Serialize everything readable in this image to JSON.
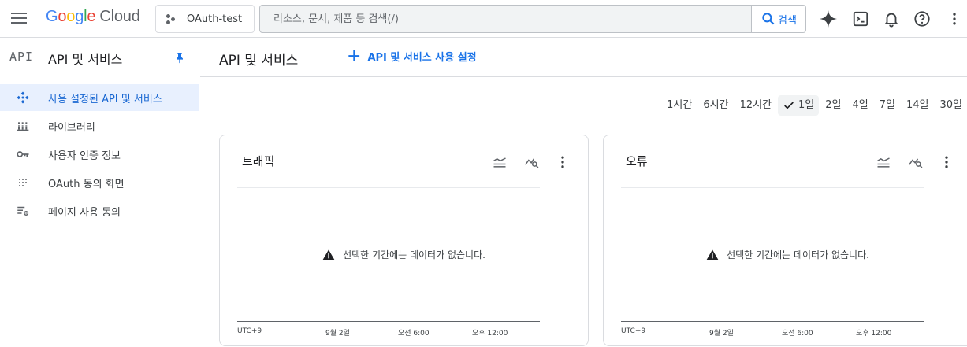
{
  "header": {
    "logo_letters": [
      "G",
      "o",
      "o",
      "g",
      "l",
      "e"
    ],
    "logo_suffix": "Cloud",
    "project_name": "OAuth-test",
    "search_placeholder": "리소스, 문서, 제품 등 검색(/)",
    "search_button": "검색",
    "icons": [
      "menu-icon",
      "gemini-sparkle-icon",
      "cloud-shell-icon",
      "bell-icon",
      "help-icon",
      "more-vert-icon"
    ]
  },
  "sidebar": {
    "logo_text": "API",
    "title": "API 및 서비스",
    "items": [
      {
        "label": "사용 설정된 API 및 서비스",
        "icon": "api-diamond-icon",
        "active": true
      },
      {
        "label": "라이브러리",
        "icon": "library-icon",
        "active": false
      },
      {
        "label": "사용자 인증 정보",
        "icon": "key-icon",
        "active": false
      },
      {
        "label": "OAuth 동의 화면",
        "icon": "consent-dots-icon",
        "active": false
      },
      {
        "label": "페이지 사용 동의",
        "icon": "settings-list-icon",
        "active": false
      }
    ]
  },
  "main": {
    "title": "API 및 서비스",
    "enable_button": "API 및 서비스 사용 설정",
    "ranges": [
      "1시간",
      "6시간",
      "12시간",
      "1일",
      "2일",
      "4일",
      "7일",
      "14일",
      "30일"
    ],
    "selected_range": "1일"
  },
  "cards": [
    {
      "title": "트래픽",
      "no_data": "선택한 기간에는 데이터가 없습니다.",
      "ticks": [
        "UTC+9",
        "9월 2일",
        "오전 6:00",
        "오후 12:00"
      ]
    },
    {
      "title": "오류",
      "no_data": "선택한 기간에는 데이터가 없습니다.",
      "ticks": [
        "UTC+9",
        "9월 2일",
        "오전 6:00",
        "오후 12:00"
      ]
    }
  ],
  "colors": {
    "accent": "#1a73e8",
    "active_bg": "#e8f0fe",
    "border": "#dadce0",
    "text": "#202124"
  }
}
